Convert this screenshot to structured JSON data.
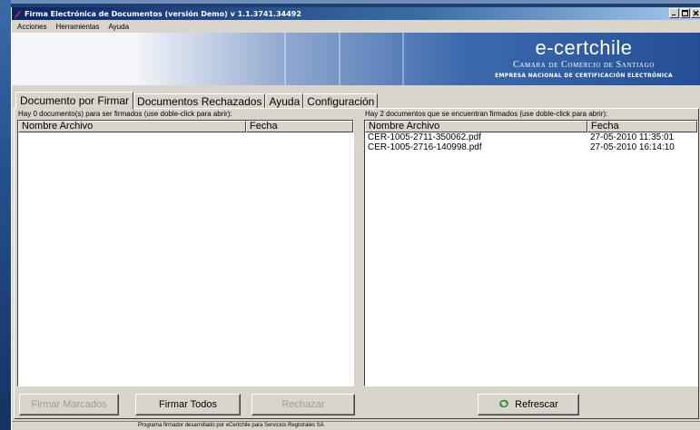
{
  "window": {
    "title": "Firma Electrónica de Documentos (versión Demo) v 1.1.3741.34492"
  },
  "menu": [
    "Acciones",
    "Herramientas",
    "Ayuda"
  ],
  "brand": {
    "name": "e-certchile",
    "line1": "Camara de Comercio de Santiago",
    "line2": "EMPRESA NACIONAL DE CERTIFICACIÓN ELECTRÓNICA"
  },
  "tabs": [
    "Documento por Firmar",
    "Documentos Rechazados",
    "Ayuda",
    "Configuración"
  ],
  "left_panel": {
    "caption": "Hay 0 documento(s) para ser firmados (use doble-click para abrir):",
    "columns": [
      "Nombre Archivo",
      "Fecha"
    ],
    "rows": []
  },
  "right_panel": {
    "caption": "Hay 2 documentos que se encuentran firmados (use doble-click para abrir):",
    "columns": [
      "Nombre Archivo",
      "Fecha"
    ],
    "rows": [
      [
        "CER-1005-2711-350062.pdf",
        "27-05-2010 11:35:01"
      ],
      [
        "CER-1005-2716-140998.pdf",
        "27-05-2010 16:14:10"
      ]
    ]
  },
  "buttons": {
    "sign_marked": "Firmar Marcados",
    "sign_all": "Firmar Todos",
    "reject": "Rechazar",
    "refresh": "Refrescar"
  },
  "status": "Programa firmador desarrollado por eCertchile para Servicios Registrales SA",
  "colors": {
    "titlebar_start": "#0a246a",
    "banner_end": "#244f96",
    "window_bg": "#d9d5cc"
  }
}
